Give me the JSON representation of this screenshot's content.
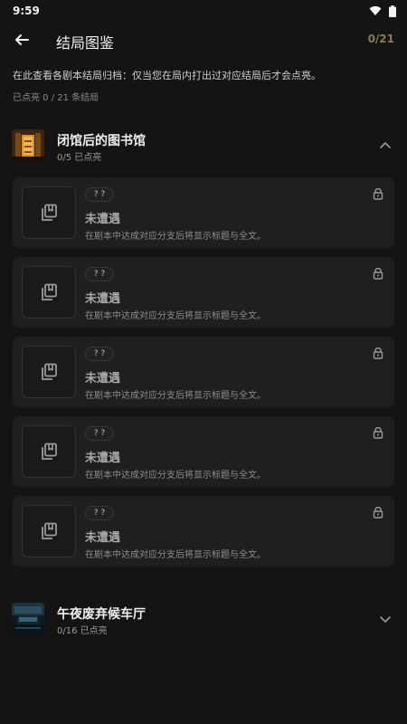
{
  "status_bar": {
    "time": "9:59",
    "icons": [
      "wifi-icon",
      "battery-icon"
    ]
  },
  "header": {
    "title": "结局图鉴",
    "counter": "0/21"
  },
  "description": "在此查看各剧本结局归档：仅当您在局内打出过对应结局后才会点亮。",
  "lit_summary": "已点亮 0 / 21 条结局",
  "colors": {
    "background": "#141414",
    "card": "#1f1f1f",
    "accent_counter": "#8c7a5a"
  },
  "sections": [
    {
      "name": "闭馆后的图书馆",
      "count": "0/5 已点亮",
      "expanded": true,
      "chevron": "chevron-up-icon",
      "endings": [
        {
          "badge": "? ?",
          "title": "未遭遇",
          "hint": "在剧本中达成对应分支后将显示标题与全文。"
        },
        {
          "badge": "? ?",
          "title": "未遭遇",
          "hint": "在剧本中达成对应分支后将显示标题与全文。"
        },
        {
          "badge": "? ?",
          "title": "未遭遇",
          "hint": "在剧本中达成对应分支后将显示标题与全文。"
        },
        {
          "badge": "? ?",
          "title": "未遭遇",
          "hint": "在剧本中达成对应分支后将显示标题与全文。"
        },
        {
          "badge": "? ?",
          "title": "未遭遇",
          "hint": "在剧本中达成对应分支后将显示标题与全文。"
        }
      ]
    },
    {
      "name": "午夜废弃候车厅",
      "count": "0/16 已点亮",
      "expanded": false,
      "chevron": "chevron-down-icon"
    }
  ]
}
